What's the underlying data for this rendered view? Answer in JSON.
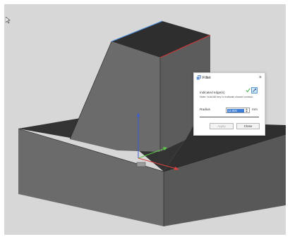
{
  "dialog": {
    "title": "Fillet",
    "close_glyph": "×",
    "icon": "fillet-icon",
    "edges_label": "Indicated edge(s)",
    "note": "Note: hold Alt key to indicate closed contour.",
    "radius_label": "Radius",
    "radius_value": "12.000",
    "unit": "mm",
    "apply_label": "Apply",
    "close_label": "Close"
  },
  "colors": {
    "viewport_bg": "#d7d7d7",
    "x_axis": "#d94040",
    "y_axis": "#5cc646",
    "z_axis": "#3b5bd8",
    "edge_red": "#c83a3a",
    "edge_blue": "#4a8ad8",
    "selection_blue": "#3d7fd8"
  }
}
